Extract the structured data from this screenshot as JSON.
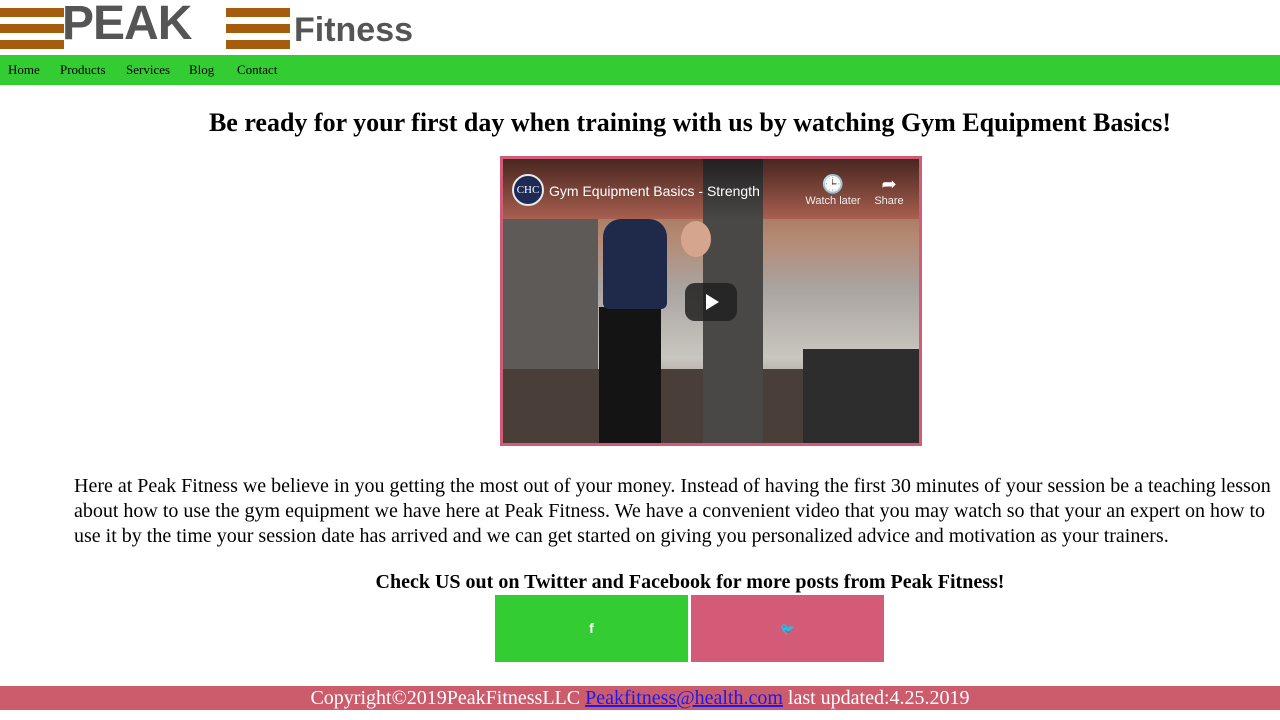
{
  "logo": {
    "peak": "PEAK",
    "fitness": "Fitness",
    "bar_color": "#a55d0d",
    "text_color": "#555555"
  },
  "nav": {
    "background": "#33cc33",
    "items": [
      "Home",
      "Products",
      "Services",
      "Blog",
      "Contact"
    ]
  },
  "main": {
    "headline": "Be ready for your first day when training with us by watching Gym Equipment Basics!",
    "video": {
      "title": "Gym Equipment Basics - Strength",
      "channel_initials": "CHC",
      "watch_later": "Watch later",
      "share": "Share",
      "frame_color": "#d45b78"
    },
    "paragraph": "Here at Peak Fitness we believe in you getting the most out of your money. Instead of having the first 30 minutes of your session be a teaching lesson about how to use the gym equipment we have here at Peak Fitness. We have a convenient video that you may watch so that your an expert on how to use it by the time your session date has arrived and we can get started on giving you personalized advice and motivation as your trainers.",
    "social_heading": "Check US out on Twitter and Facebook for more posts from Peak Fitness!",
    "social": {
      "facebook_icon": "f",
      "twitter_icon": "🐦",
      "facebook_color": "#33cc33",
      "twitter_color": "#d45b78"
    }
  },
  "footer": {
    "copyright": "Copyright©2019PeakFitnessLLC",
    "email": "Peakfitness@health.com",
    "updated": "last updated:4.25.2019",
    "background": "#cc5b6c"
  }
}
